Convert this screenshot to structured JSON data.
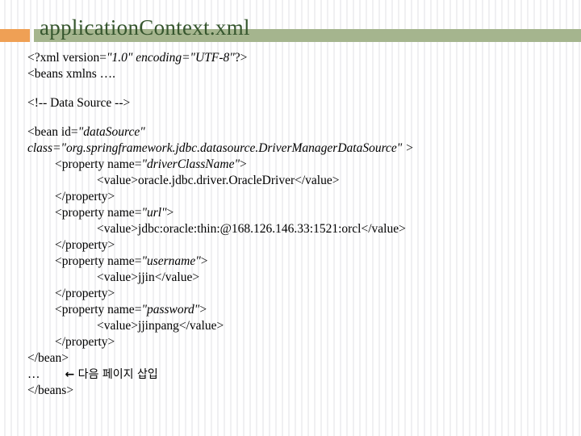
{
  "slide": {
    "title": "applicationContext.xml",
    "accent_color": "#efa055",
    "bar_color": "#a5b58e",
    "title_color": "#36562e",
    "background_color": "#ffffff",
    "stripe_color": "#f0f0f2"
  },
  "code": {
    "lines": [
      {
        "indent": 0,
        "parts": [
          {
            "text": "<?xml version=",
            "italic": false
          },
          {
            "text": "\"1.0\" ",
            "italic": true
          },
          {
            "text": "encoding=",
            "italic": true
          },
          {
            "text": "\"UTF-8\"",
            "italic": true
          },
          {
            "text": "?>",
            "italic": false
          }
        ]
      },
      {
        "indent": 0,
        "parts": [
          {
            "text": "<beans xmlns ….",
            "italic": false
          }
        ]
      },
      {
        "blank": true
      },
      {
        "indent": 0,
        "parts": [
          {
            "text": "<!-- Data Source -->",
            "italic": false
          }
        ]
      },
      {
        "blank": true
      },
      {
        "indent": 0,
        "parts": [
          {
            "text": "<bean id=",
            "italic": false
          },
          {
            "text": "\"dataSource\"",
            "italic": true
          }
        ]
      },
      {
        "indent": 0,
        "parts": [
          {
            "text": "class=\"org.springframework.jdbc.datasource.DriverManagerDataSource\" >",
            "italic": true
          }
        ]
      },
      {
        "indent": 1,
        "parts": [
          {
            "text": "<property name=",
            "italic": false
          },
          {
            "text": "\"driverClassName\"",
            "italic": true
          },
          {
            "text": ">",
            "italic": false
          }
        ]
      },
      {
        "indent": 2,
        "parts": [
          {
            "text": "<value>oracle.jdbc.driver.OracleDriver</value>",
            "italic": false
          }
        ]
      },
      {
        "indent": 1,
        "parts": [
          {
            "text": "</property>",
            "italic": false
          }
        ]
      },
      {
        "indent": 1,
        "parts": [
          {
            "text": "<property name=",
            "italic": false
          },
          {
            "text": "\"url\"",
            "italic": true
          },
          {
            "text": ">",
            "italic": false
          }
        ]
      },
      {
        "indent": 2,
        "parts": [
          {
            "text": "<value>jdbc:oracle:thin:@168.126.146.33:1521:orcl</value>",
            "italic": false
          }
        ]
      },
      {
        "indent": 1,
        "parts": [
          {
            "text": "</property>",
            "italic": false
          }
        ]
      },
      {
        "indent": 1,
        "parts": [
          {
            "text": "<property name=",
            "italic": false
          },
          {
            "text": "\"username\"",
            "italic": true
          },
          {
            "text": ">",
            "italic": false
          }
        ]
      },
      {
        "indent": 2,
        "parts": [
          {
            "text": "<value>jjin</value>",
            "italic": false
          }
        ]
      },
      {
        "indent": 1,
        "parts": [
          {
            "text": "</property>",
            "italic": false
          }
        ]
      },
      {
        "indent": 1,
        "parts": [
          {
            "text": "<property name=",
            "italic": false
          },
          {
            "text": "\"password\"",
            "italic": true
          },
          {
            "text": ">",
            "italic": false
          }
        ]
      },
      {
        "indent": 2,
        "parts": [
          {
            "text": "<value>jjinpang</value>",
            "italic": false
          }
        ]
      },
      {
        "indent": 1,
        "parts": [
          {
            "text": "</property>",
            "italic": false
          }
        ]
      },
      {
        "indent": 0,
        "parts": [
          {
            "text": "</bean>",
            "italic": false
          }
        ]
      },
      {
        "indent": 0,
        "parts": [
          {
            "text": "…",
            "italic": false
          },
          {
            "text": "        ",
            "italic": false
          },
          {
            "text": "←",
            "italic": false,
            "style": "arrow"
          },
          {
            "text": " 다음 페이지 삽입",
            "italic": false,
            "style": "ko"
          }
        ]
      },
      {
        "indent": 0,
        "parts": [
          {
            "text": "</beans>",
            "italic": false
          }
        ]
      }
    ]
  }
}
